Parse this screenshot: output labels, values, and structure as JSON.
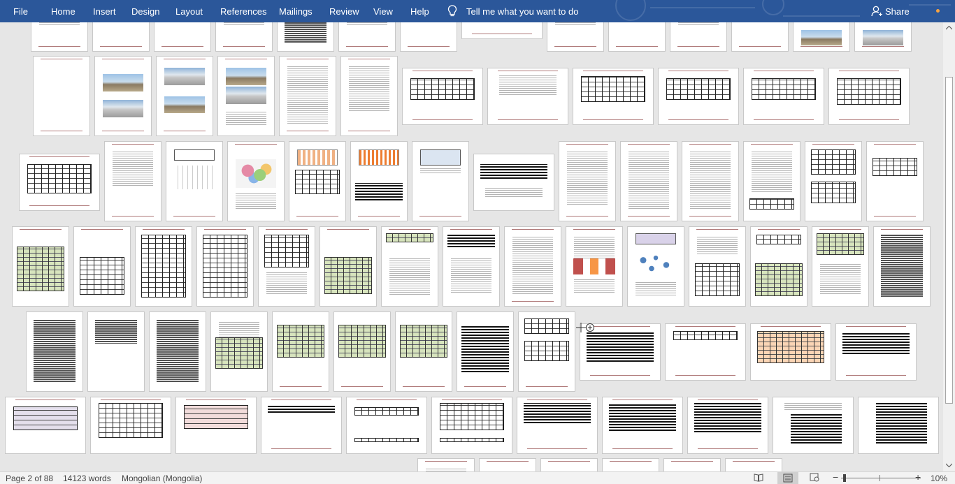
{
  "ribbon": {
    "tabs": [
      "File",
      "Home",
      "Insert",
      "Design",
      "Layout",
      "References",
      "Mailings",
      "Review",
      "View",
      "Help"
    ],
    "tell_me": "Tell me what you want to do",
    "share": "Share",
    "accent_color": "#2b579a"
  },
  "status": {
    "page": "Page 2 of 88",
    "words": "14123 words",
    "language": "Mongolian (Mongolia)",
    "zoom": "10%",
    "zoom_minus": "−",
    "zoom_plus": "+"
  },
  "icons": {
    "tell_me": "lightbulb-icon",
    "share": "person-icon",
    "read_mode": "read-mode-icon",
    "print_layout": "print-layout-icon",
    "web_layout": "web-layout-icon",
    "scroll_up": "chevron-up-icon",
    "scroll_down": "chevron-down-icon",
    "move_cursor": "move-cursor-icon"
  },
  "scroll_position": 0.06
}
